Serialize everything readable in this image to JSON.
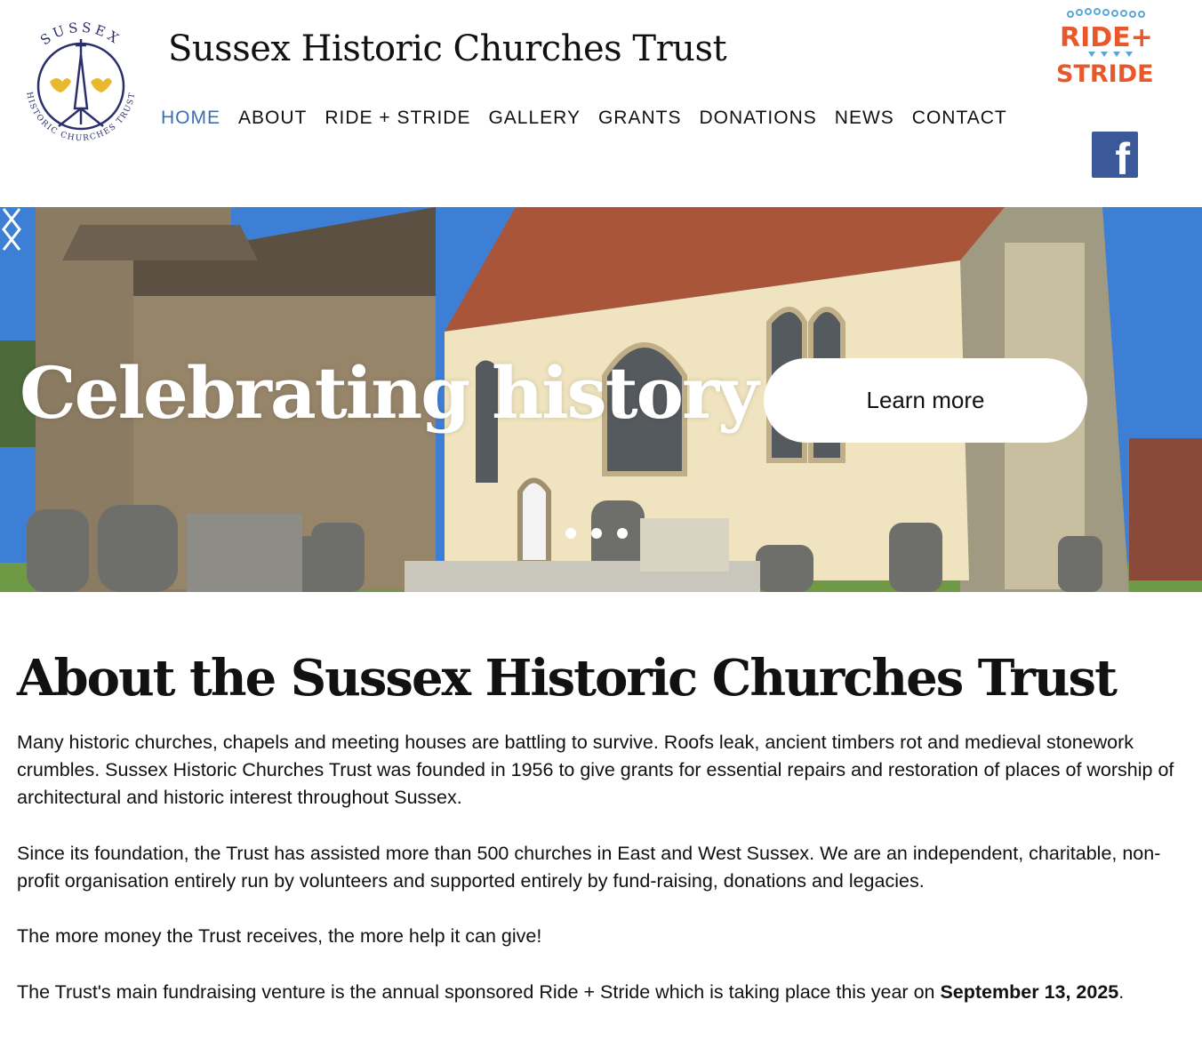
{
  "header": {
    "logo_ring_text": "SUSSEX HISTORIC CHURCHES TRUST",
    "site_title": "Sussex Historic Churches Trust",
    "nav": [
      "HOME",
      "ABOUT",
      "RIDE + STRIDE",
      "GALLERY",
      "GRANTS",
      "DONATIONS",
      "NEWS",
      "CONTACT"
    ],
    "active_nav": "HOME",
    "ride_stride_logo": {
      "line1": "RIDE+",
      "line2": "STRIDE"
    },
    "facebook_icon": "facebook-icon",
    "facebook_letter": "f"
  },
  "hero": {
    "title": "Celebrating history",
    "button_label": "Learn more",
    "slide_count": 3,
    "colors": {
      "sky": "#3e7fd6",
      "roof": "#a8553a",
      "render": "#efe4bf",
      "stone": "#8b7b62"
    }
  },
  "about": {
    "title": "About the Sussex Historic Churches Trust",
    "p1": "Many historic churches, chapels and meeting houses are battling to survive. Roofs leak, ancient timbers rot and medieval stonework crumbles. Sussex Historic Churches Trust was founded in 1956 to give grants for essential repairs and restoration of places of worship of architectural and historic interest throughout Sussex.",
    "p2": "Since its foundation, the Trust has assisted more than 500 churches in East and West Sussex. We are an independent, charitable, non-profit organisation entirely run by volunteers and supported entirely by fund-raising, donations and legacies.",
    "p3": "The more money the Trust receives, the more help it can give!",
    "p4_text": "The Trust's main fundraising venture is the annual sponsored Ride + Stride which is taking place this year on ",
    "p4_date": "September 13, 2025",
    "p4_end": "."
  },
  "colors": {
    "accent": "#3a6fb8",
    "facebook": "#3b5998",
    "ride_stride_orange": "#e8582a",
    "logo_navy": "#2b2f6b",
    "logo_gold": "#e8b82e"
  }
}
